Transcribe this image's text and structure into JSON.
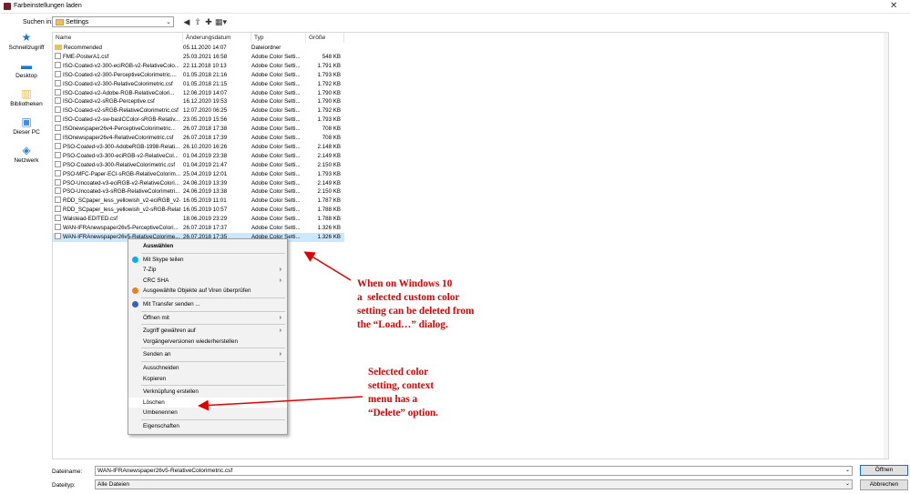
{
  "window": {
    "title": "Farbeinstellungen laden",
    "close_glyph": "✕"
  },
  "toolbar": {
    "look_in_label": "Suchen in:",
    "look_in_value": "Settings",
    "buttons": [
      {
        "name": "back-icon",
        "glyph": "◀"
      },
      {
        "name": "up-folder-icon",
        "glyph": "⇧"
      },
      {
        "name": "new-folder-icon",
        "glyph": "✚"
      },
      {
        "name": "view-menu-icon",
        "glyph": "▦▾"
      }
    ]
  },
  "places": [
    {
      "label": "Schnellzugriff",
      "icon": "star-icon",
      "color": "#1e73d4"
    },
    {
      "label": "Desktop",
      "icon": "desktop-icon",
      "color": "#1f78d1"
    },
    {
      "label": "Bibliotheken",
      "icon": "libraries-icon",
      "color": "#e8b93c"
    },
    {
      "label": "Dieser PC",
      "icon": "computer-icon",
      "color": "#3a8ee6"
    },
    {
      "label": "Netzwerk",
      "icon": "network-icon",
      "color": "#2f7fd6"
    }
  ],
  "columns": [
    "Name",
    "Änderungsdatum",
    "Typ",
    "Größe"
  ],
  "files": [
    {
      "name": "Recommended",
      "date": "05.11.2020 14:07",
      "type": "Dateiordner",
      "size": "",
      "folder": true
    },
    {
      "name": "FME-PosterA1.csf",
      "date": "25.03.2021 16:58",
      "type": "Adobe Color Setti...",
      "size": "548 KB"
    },
    {
      "name": "ISO-Coated-v2-300-eciRGB-v2-RelativeColo...",
      "date": "22.11.2018 10:13",
      "type": "Adobe Color Setti...",
      "size": "1.791 KB"
    },
    {
      "name": "ISO-Coated-v2-300-PerceptiveColorimetric....",
      "date": "01.05.2018 21:16",
      "type": "Adobe Color Setti...",
      "size": "1.793 KB"
    },
    {
      "name": "ISO-Coated-v2-300-RelativeColorimetric.csf",
      "date": "01.05.2018 21:15",
      "type": "Adobe Color Setti...",
      "size": "1.792 KB"
    },
    {
      "name": "ISO-Coated-v2-Adobe-RGB-RelativeColori...",
      "date": "12.06.2019 14:07",
      "type": "Adobe Color Setti...",
      "size": "1.790 KB"
    },
    {
      "name": "ISO-Coated-v2-sRGB-Perceptive.csf",
      "date": "16.12.2020 19:53",
      "type": "Adobe Color Setti...",
      "size": "1.790 KB"
    },
    {
      "name": "ISO-Coated-v2-sRGB-RelativeColorimetric.csf",
      "date": "12.07.2020 06:25",
      "type": "Adobe Color Setti...",
      "size": "1.792 KB"
    },
    {
      "name": "ISO-Coated-v2-sw-basICColor-sRGB-Relativ...",
      "date": "23.05.2019 15:56",
      "type": "Adobe Color Setti...",
      "size": "1.793 KB"
    },
    {
      "name": "ISOnewspaper26v4-PerceptiveColorimetric...",
      "date": "26.07.2018 17:38",
      "type": "Adobe Color Setti...",
      "size": "708 KB"
    },
    {
      "name": "ISOnewspaper26v4-RelativeColorimetric.csf",
      "date": "26.07.2018 17:39",
      "type": "Adobe Color Setti...",
      "size": "708 KB"
    },
    {
      "name": "PSO-Coated-v3-300-AdobeRGB-1998-Relati...",
      "date": "26.10.2020 16:26",
      "type": "Adobe Color Setti...",
      "size": "2.148 KB"
    },
    {
      "name": "PSO-Coated-v3-300-eciRGB-v2-RelativeCol...",
      "date": "01.04.2019 23:38",
      "type": "Adobe Color Setti...",
      "size": "2.149 KB"
    },
    {
      "name": "PSO-Coated-v3-300-RelativeColorimetric.csf",
      "date": "01.04.2019 21:47",
      "type": "Adobe Color Setti...",
      "size": "2.150 KB"
    },
    {
      "name": "PSO-MFC-Paper-ECI-sRGB-RelativeColorim...",
      "date": "25.04.2019 12:01",
      "type": "Adobe Color Setti...",
      "size": "1.793 KB"
    },
    {
      "name": "PSO-Uncoated-v3-eciRGB-v2-RelativeColori...",
      "date": "24.06.2019 13:39",
      "type": "Adobe Color Setti...",
      "size": "2.149 KB"
    },
    {
      "name": "PSO-Uncoated-v3-sRGB-RelativeColorimetri...",
      "date": "24.06.2019 13:38",
      "type": "Adobe Color Setti...",
      "size": "2.150 KB"
    },
    {
      "name": "RDD_SCpaper_less_yellowish_v2-eciRGB_v2-...",
      "date": "16.05.2019 11:01",
      "type": "Adobe Color Setti...",
      "size": "1.787 KB"
    },
    {
      "name": "RDD_SCpaper_less_yellowish_v2-sRGB-Relati...",
      "date": "16.05.2019 10:57",
      "type": "Adobe Color Setti...",
      "size": "1.788 KB"
    },
    {
      "name": "Walstead-EDITED.csf",
      "date": "18.06.2019 23:29",
      "type": "Adobe Color Setti...",
      "size": "1.788 KB"
    },
    {
      "name": "WAN-IFRAnewspaper26v5-PerceptiveColori...",
      "date": "26.07.2018 17:37",
      "type": "Adobe Color Setti...",
      "size": "1.326 KB"
    },
    {
      "name": "WAN-IFRAnewspaper26v5-RelativeColorime...",
      "date": "26.07.2018 17:35",
      "type": "Adobe Color Setti...",
      "size": "1.326 KB",
      "selected": true
    }
  ],
  "context_menu": [
    {
      "label": "Auswählen",
      "bold": true
    },
    {
      "sep": true
    },
    {
      "label": "Mit Skype teilen",
      "icon": "skype-icon",
      "icon_color": "#00aff0"
    },
    {
      "label": "7-Zip",
      "submenu": true
    },
    {
      "label": "CRC SHA",
      "submenu": true
    },
    {
      "label": "Ausgewählte Objekte auf Viren überprüfen",
      "icon": "antivirus-icon",
      "icon_color": "#f07f1a"
    },
    {
      "sep": true
    },
    {
      "label": "Mit Transfer senden ...",
      "icon": "transfer-icon",
      "icon_color": "#3b5fc0"
    },
    {
      "sep": true
    },
    {
      "label": "Öffnen mit",
      "submenu": true
    },
    {
      "sep": true
    },
    {
      "label": "Zugriff gewähren auf",
      "submenu": true
    },
    {
      "label": "Vorgängerversionen wiederherstellen"
    },
    {
      "sep": true
    },
    {
      "label": "Senden an",
      "submenu": true
    },
    {
      "sep": true
    },
    {
      "label": "Ausschneiden"
    },
    {
      "label": "Kopieren"
    },
    {
      "sep": true
    },
    {
      "label": "Verknüpfung erstellen"
    },
    {
      "label": "Löschen",
      "highlight": true
    },
    {
      "label": "Umbenennen"
    },
    {
      "sep": true
    },
    {
      "label": "Eigenschaften"
    }
  ],
  "bottom": {
    "filename_label": "Dateiname:",
    "filename_value": "WAN-IFRAnewspaper26v5-RelativeColorimetric.csf",
    "filetype_label": "Dateityp:",
    "filetype_value": "Alle Dateien",
    "open_button": "Öffnen",
    "cancel_button": "Abbrechen"
  },
  "annotations": {
    "note1": "When on Windows 10\na  selected custom color\nsetting can be deleted from\nthe “Load…” dialog.",
    "note2": "Selected color\nsetting, context\nmenu has a\n“Delete” option.",
    "color": "#e00000"
  }
}
